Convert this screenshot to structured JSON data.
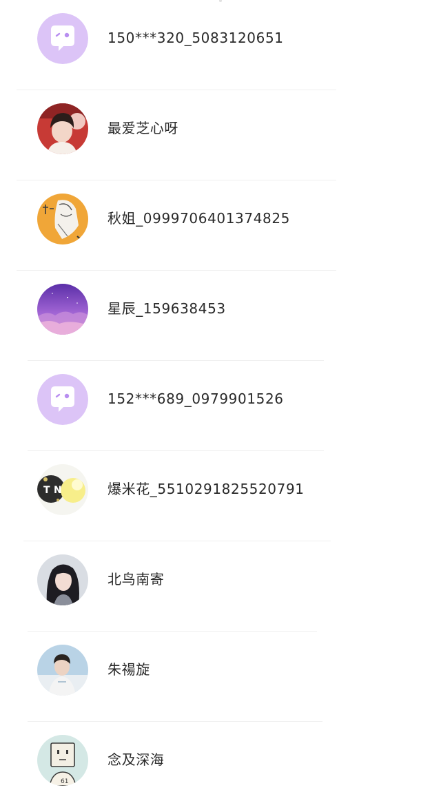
{
  "contacts": [
    {
      "name": "150***320_5083120651",
      "avatar": "default-chat-avatar-icon"
    },
    {
      "name": "最爱芝心呀",
      "avatar": "user-photo-avatar"
    },
    {
      "name": "秋姐_0999706401374825",
      "avatar": "anime-drawing-avatar"
    },
    {
      "name": "星辰_159638453",
      "avatar": "purple-sky-avatar"
    },
    {
      "name": "152***689_0979901526",
      "avatar": "default-chat-avatar-icon"
    },
    {
      "name": "爆米花_5510291825520791",
      "avatar": "tn-glitter-avatar"
    },
    {
      "name": "北鸟南寄",
      "avatar": "girl-photo-avatar"
    },
    {
      "name": "朱禓旋",
      "avatar": "boy-photo-avatar"
    },
    {
      "name": "念及深海",
      "avatar": "box-head-cartoon-avatar"
    }
  ],
  "colors": {
    "default_avatar_bg": "#dcc4f7",
    "default_avatar_bubble": "#ffffff",
    "default_avatar_face": "#b88ef0",
    "name_text": "#2a2a2a",
    "divider": "#efefef"
  }
}
